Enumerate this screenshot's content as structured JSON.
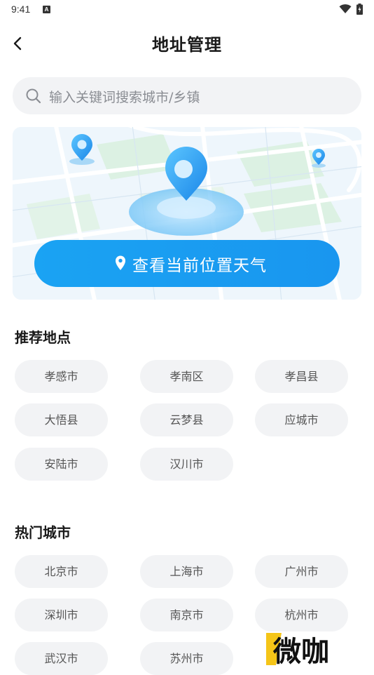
{
  "status_bar": {
    "time": "9:41",
    "notification_letter": "A"
  },
  "header": {
    "title": "地址管理"
  },
  "search": {
    "placeholder": "输入关键词搜索城市/乡镇"
  },
  "locate": {
    "label": "查看当前位置天气"
  },
  "recommended": {
    "title": "推荐地点",
    "items": [
      "孝感市",
      "孝南区",
      "孝昌县",
      "大悟县",
      "云梦县",
      "应城市",
      "安陆市",
      "汉川市"
    ]
  },
  "hot_cities": {
    "title": "热门城市",
    "items": [
      "北京市",
      "上海市",
      "广州市",
      "深圳市",
      "南京市",
      "杭州市",
      "武汉市",
      "苏州市"
    ]
  },
  "watermark": {
    "text": "微咖"
  },
  "colors": {
    "accent": "#1aa3f3",
    "chip_bg": "#f2f3f5",
    "search_bg": "#f2f3f5"
  },
  "icons": [
    "back-icon",
    "search-icon",
    "location-pin-icon",
    "wifi-icon",
    "battery-icon"
  ]
}
